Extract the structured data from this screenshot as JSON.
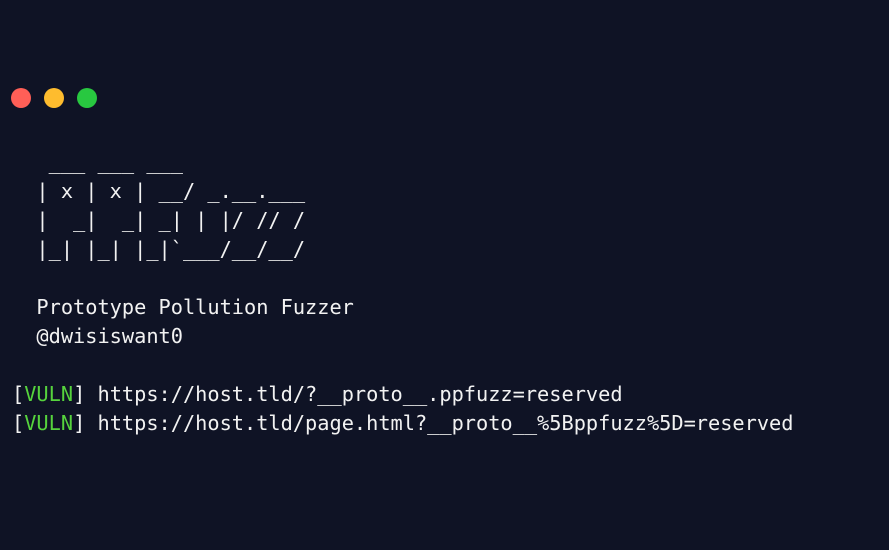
{
  "window": {
    "traffic_lights": {
      "close_color": "#ff5f57",
      "minimize_color": "#febc2e",
      "maximize_color": "#28c840"
    }
  },
  "terminal": {
    "colors": {
      "background": "#0f1325",
      "text": "#f2f2f2",
      "vuln": "#56d33d"
    },
    "banner": [
      "   ___ ___ ___",
      "  | x | x | __/ _.__.___",
      "  |  _|  _| _| | |/ // /",
      "  |_| |_| |_|`___/__/__/"
    ],
    "title": "  Prototype Pollution Fuzzer",
    "author": "  @dwisiswant0",
    "results": [
      {
        "open": "[",
        "tag": "VULN",
        "close": "] ",
        "url": "https://host.tld/?__proto__.ppfuzz=reserved"
      },
      {
        "open": "[",
        "tag": "VULN",
        "close": "] ",
        "url": "https://host.tld/page.html?__proto__%5Bppfuzz%5D=reserved"
      }
    ]
  }
}
